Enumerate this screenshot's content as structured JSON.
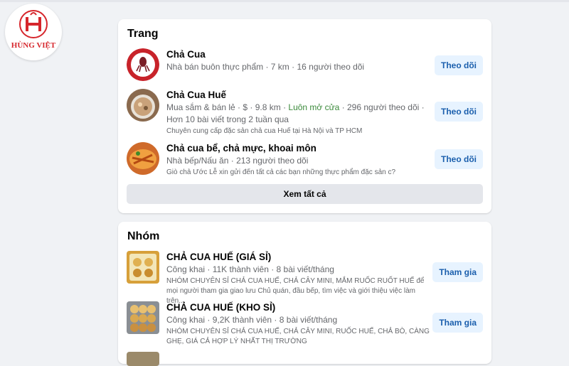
{
  "brand": {
    "logo_text": "HÙNG VIỆT",
    "accent": "#d6262c"
  },
  "pages_section": {
    "title": "Trang",
    "items": [
      {
        "name": "Chả Cua",
        "meta": "Nhà bán buôn thực phẩm · 7 km · 16 người theo dõi",
        "button": "Theo dõi"
      },
      {
        "name": "Chả Cua Huế",
        "meta_before": "Mua sắm & bán lẻ · $ · 9.8 km · ",
        "meta_open": "Luôn mở cửa",
        "meta_after": " · 296 người theo dõi · Hơn 10 bài viết trong 2 tuần qua",
        "desc": "Chuyên cung cấp đặc sản chả cua Huế tại Hà Nội và TP HCM",
        "button": "Theo dõi"
      },
      {
        "name": "Chả cua bể, chả mực, khoai môn",
        "meta": "Nhà bếp/Nấu ăn · 213 người theo dõi",
        "desc": "Giò chả Ước Lễ xin gửi đến tất cả các bạn những thực phẩm đặc sản c?",
        "button": "Theo dõi"
      }
    ],
    "see_all": "Xem tất cả"
  },
  "groups_section": {
    "title": "Nhóm",
    "items": [
      {
        "name": "CHẢ CUA HUẾ (GIÁ SỈ)",
        "meta": "Công khai · 11K thành viên · 8 bài viết/tháng",
        "desc": "NHÓM CHUYÊN SỈ CHẢ CUA HUẾ, CHẢ CÂY MINI, MẮM RUỐC RUỐT HUẾ để mọi người tham gia giao lưu Chủ quán, đầu bếp, tìm việc và giới thiệu việc làm trên...",
        "button": "Tham gia"
      },
      {
        "name": "CHẢ CUA HUẾ (KHO SỈ)",
        "meta": "Công khai · 9,2K thành viên · 8 bài viết/tháng",
        "desc": "NHÓM CHUYÊN SỈ CHẢ CUA HUẾ, CHẢ CÂY MINI, RUỐC HUẾ, CHẢ BÒ, CÀNG GHẸ, GIÁ CẢ HỢP LÝ NHẤT THỊ TRƯỜNG",
        "button": "Tham gia"
      }
    ]
  },
  "colors": {
    "button_bg": "#e7f3ff",
    "button_text": "#1b5fad",
    "open_status": "#3b8a3b"
  }
}
